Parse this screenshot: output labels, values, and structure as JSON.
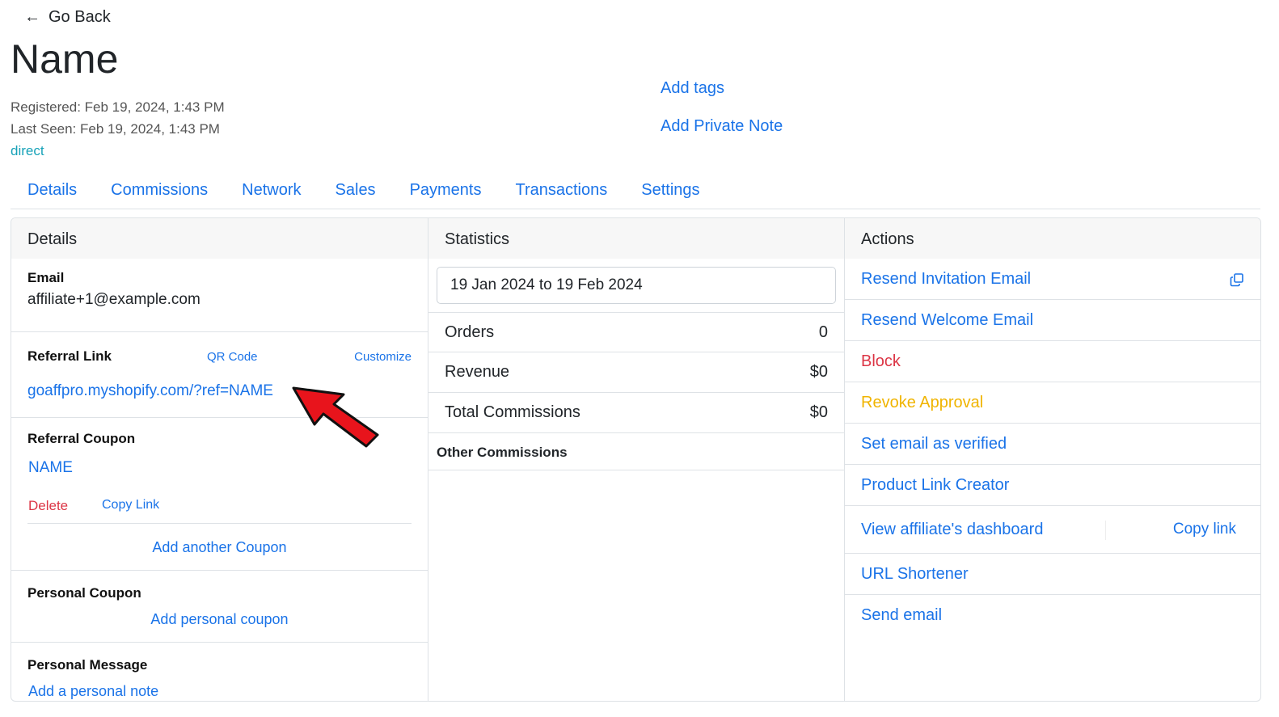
{
  "nav": {
    "back_label": "Go Back"
  },
  "profile": {
    "name": "Name",
    "registered": "Registered: Feb 19, 2024, 1:43 PM",
    "last_seen": "Last Seen: Feb 19, 2024, 1:43 PM",
    "source": "direct",
    "add_tags": "Add tags",
    "add_private_note": "Add Private Note"
  },
  "tabs": [
    "Details",
    "Commissions",
    "Network",
    "Sales",
    "Payments",
    "Transactions",
    "Settings"
  ],
  "details": {
    "header": "Details",
    "email_label": "Email",
    "email_value": "affiliate+1@example.com",
    "referral_link_label": "Referral Link",
    "qr_code": "QR Code",
    "customize": "Customize",
    "referral_link": "goaffpro.myshopify.com/?ref=NAME",
    "referral_coupon_label": "Referral Coupon",
    "coupon_code": "NAME",
    "delete": "Delete",
    "copy_link": "Copy Link",
    "add_another_coupon": "Add another Coupon",
    "personal_coupon_label": "Personal Coupon",
    "add_personal_coupon": "Add personal coupon",
    "personal_message_label": "Personal Message",
    "add_personal_note": "Add a personal note"
  },
  "statistics": {
    "header": "Statistics",
    "date_range": "19 Jan 2024 to 19 Feb 2024",
    "rows": [
      {
        "label": "Orders",
        "value": "0"
      },
      {
        "label": "Revenue",
        "value": "$0"
      },
      {
        "label": "Total Commissions",
        "value": "$0"
      }
    ],
    "other_commissions": "Other Commissions"
  },
  "actions": {
    "header": "Actions",
    "resend_invitation": "Resend Invitation Email",
    "resend_welcome": "Resend Welcome Email",
    "block": "Block",
    "revoke_approval": "Revoke Approval",
    "set_email_verified": "Set email as verified",
    "product_link_creator": "Product Link Creator",
    "view_dashboard": "View affiliate's dashboard",
    "copy_link": "Copy link",
    "url_shortener": "URL Shortener",
    "send_email": "Send email"
  },
  "colors": {
    "link": "#1a73e8",
    "danger": "#dc3545",
    "warning": "#f0b400",
    "source": "#17a2b8",
    "annotation_arrow": "#e8141c"
  },
  "icons": {
    "back": "arrow-left-icon",
    "copy": "copy-icon",
    "annotation": "red-arrow-icon"
  }
}
